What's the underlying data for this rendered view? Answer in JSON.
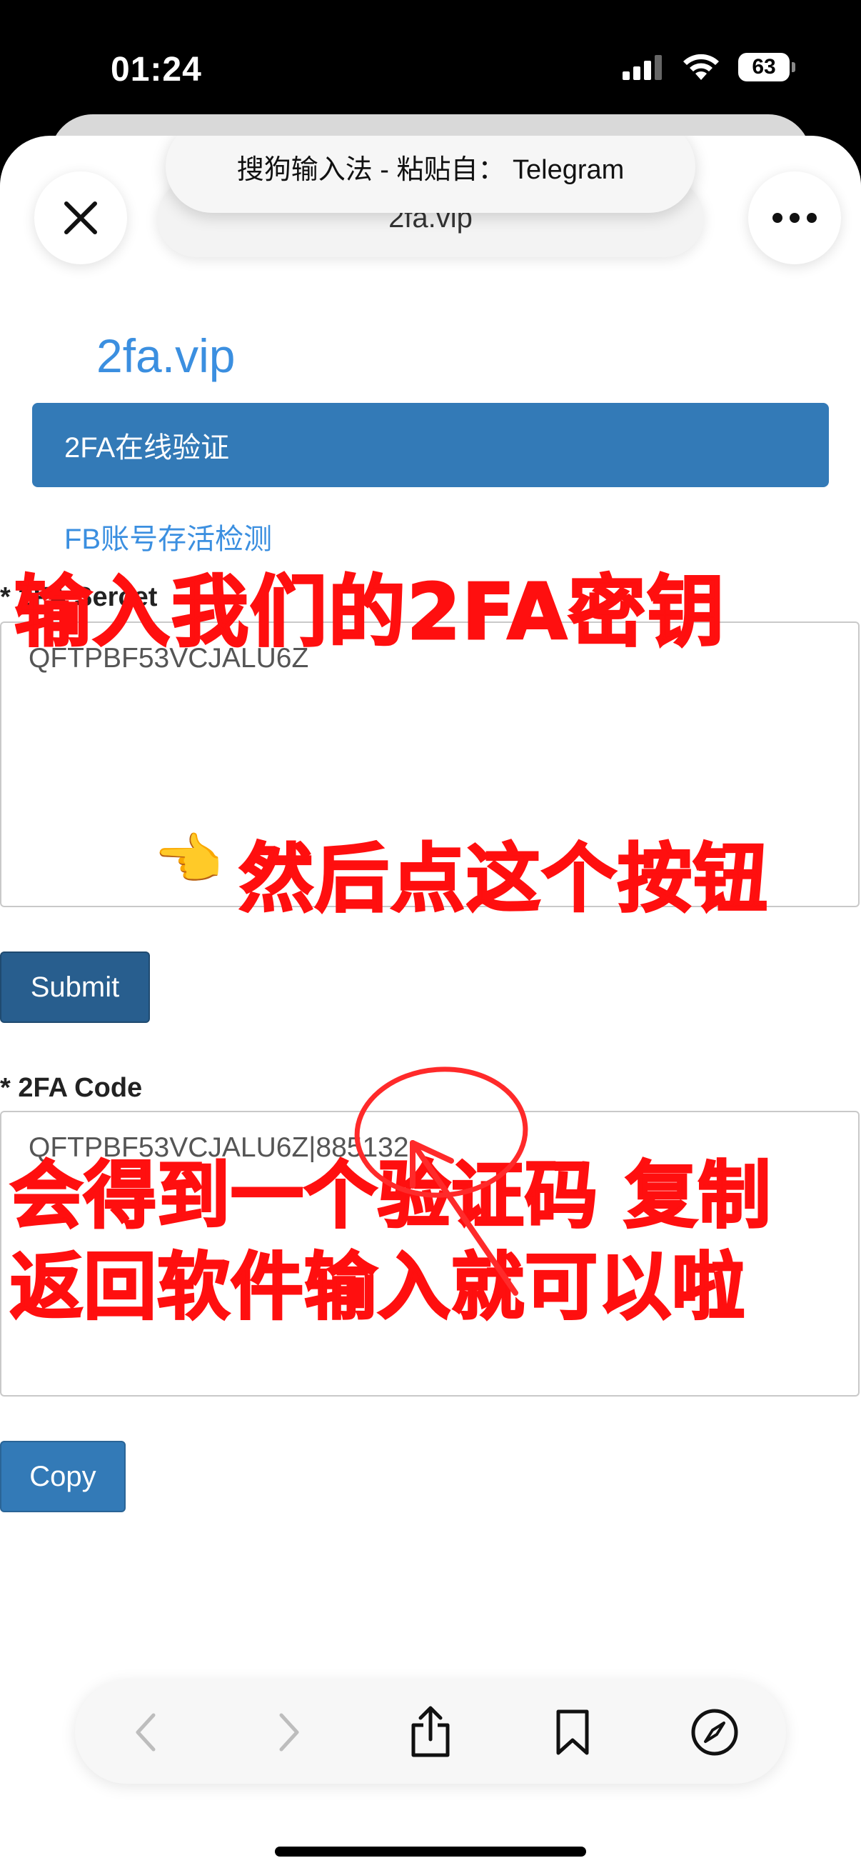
{
  "status_bar": {
    "time": "01:24",
    "battery": "63"
  },
  "browser": {
    "url": "2fa.vip",
    "paste_toast": "搜狗输入法 - 粘贴自： Telegram"
  },
  "site": {
    "logo": "2fa.vip",
    "nav_active": "2FA在线验证",
    "nav_link": "FB账号存活检测"
  },
  "form": {
    "secret_label": "* 2FA Sercet",
    "secret_value": "QFTPBF53VCJALU6Z",
    "submit_label": "Submit",
    "code_label": "* 2FA Code",
    "code_value": "QFTPBF53VCJALU6Z|885132",
    "copy_label": "Copy"
  },
  "annotations": {
    "step1": "输入我们的2FA密钥",
    "step2": "然后点这个按钮",
    "step3_line1": "会得到一个验证码 复制",
    "step3_line2": "返回软件输入就可以啦",
    "pointer_emoji": "👈",
    "color": "#ff0f0f"
  },
  "toolbar": {
    "icons": [
      "back-icon",
      "forward-icon",
      "share-icon",
      "bookmarks-icon",
      "compass-icon"
    ]
  },
  "colors": {
    "primary": "#337ab7",
    "link": "#3b8fe0",
    "annotation": "#ff0f0f"
  }
}
